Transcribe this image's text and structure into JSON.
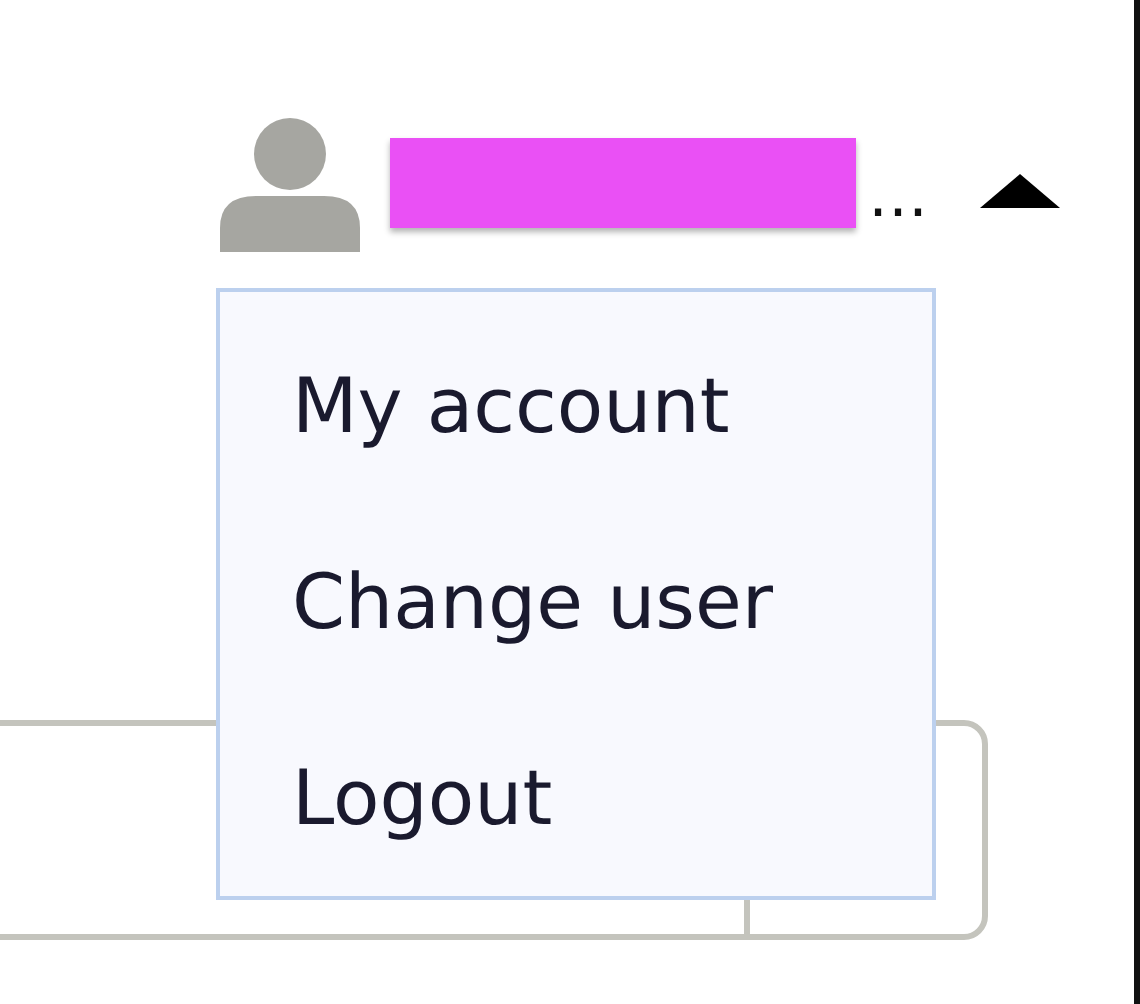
{
  "user_menu": {
    "username_suffix": "…",
    "expanded": true,
    "items": [
      {
        "label": "My account"
      },
      {
        "label": "Change user"
      },
      {
        "label": "Logout"
      }
    ]
  }
}
